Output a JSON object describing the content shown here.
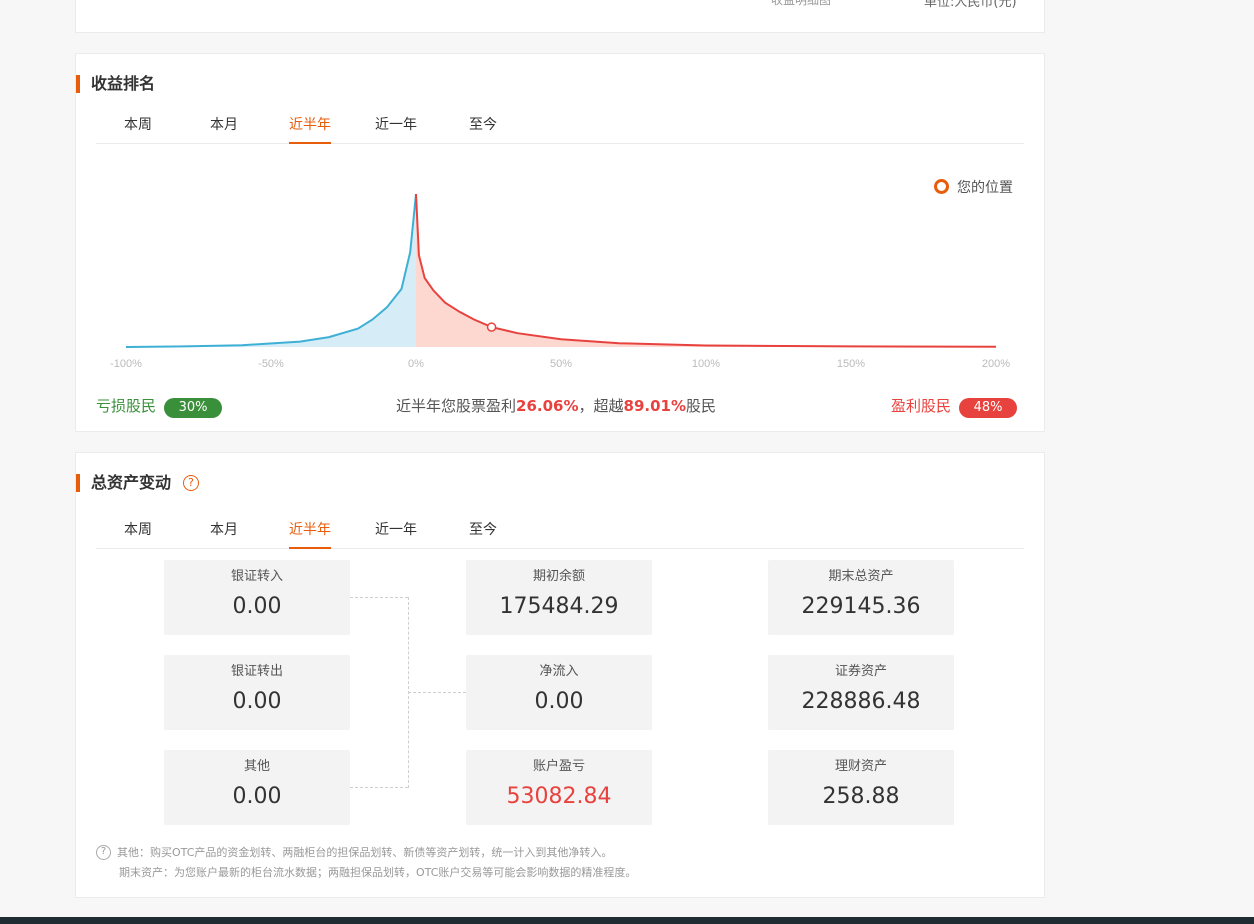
{
  "top_card": {
    "left_cut_text": "收益明细图",
    "right_cut_text": "单位:人民币(元)"
  },
  "rank": {
    "title": "收益排名",
    "tabs": [
      "本周",
      "本月",
      "近半年",
      "近一年",
      "至今"
    ],
    "active_tab": "近半年",
    "legend": "您的位置",
    "loss_label": "亏损股民",
    "loss_pct": "30%",
    "profit_label": "盈利股民",
    "profit_pct": "48%",
    "summary_prefix": "近半年您股票盈利",
    "summary_profit": "26.06%",
    "summary_middle": "，超越",
    "summary_beat": "89.01%",
    "summary_suffix": "股民"
  },
  "asset": {
    "title": "总资产变动",
    "help_icon": "question-circle-icon",
    "tabs": [
      "本周",
      "本月",
      "近半年",
      "近一年",
      "至今"
    ],
    "active_tab": "近半年",
    "left": [
      {
        "label": "银证转入",
        "value": "0.00"
      },
      {
        "label": "银证转出",
        "value": "0.00"
      },
      {
        "label": "其他",
        "value": "0.00"
      }
    ],
    "middle": [
      {
        "label": "期初余额",
        "value": "175484.29"
      },
      {
        "label": "净流入",
        "value": "0.00"
      },
      {
        "label": "账户盈亏",
        "value": "53082.84"
      }
    ],
    "right": [
      {
        "label": "期末总资产",
        "value": "229145.36"
      },
      {
        "label": "证券资产",
        "value": "228886.48"
      },
      {
        "label": "理财资产",
        "value": "258.88"
      }
    ],
    "note1": "其他：购买OTC产品的资金划转、两融柜台的担保品划转、新债等资产划转，统一计入到其他净转入。",
    "note2": "期末资产：为您账户最新的柜台流水数据；两融担保品划转，OTC账户交易等可能会影响数据的精准程度。"
  },
  "chart_data": {
    "type": "area",
    "x_tick_labels": [
      "-100%",
      "-50%",
      "0%",
      "50%",
      "100%",
      "150%",
      "200%"
    ],
    "xlim": [
      -100,
      200
    ],
    "series": [
      {
        "x": [
          -100,
          -80,
          -60,
          -40,
          -30,
          -20,
          -15,
          -10,
          -5,
          -2,
          0
        ],
        "y": [
          0,
          0.4,
          1.2,
          3.5,
          6.5,
          12,
          18,
          26,
          38,
          62,
          100
        ]
      },
      {
        "x": [
          0,
          1,
          3,
          6,
          10,
          15,
          20,
          26.06,
          35,
          50,
          70,
          100,
          150,
          200
        ],
        "y": [
          100,
          60,
          45,
          37,
          29,
          23,
          18,
          13,
          9,
          5,
          2.5,
          1,
          0.4,
          0.2
        ]
      }
    ],
    "colors": {
      "loss_line": "#3eb0d6",
      "loss_fill": "#d6ecf6",
      "profit_line": "#e8423e",
      "profit_fill": "#fdd8d1",
      "marker": "#e8423e"
    },
    "marker_x": 26.06,
    "grid": false,
    "legend_position": "top-right"
  }
}
